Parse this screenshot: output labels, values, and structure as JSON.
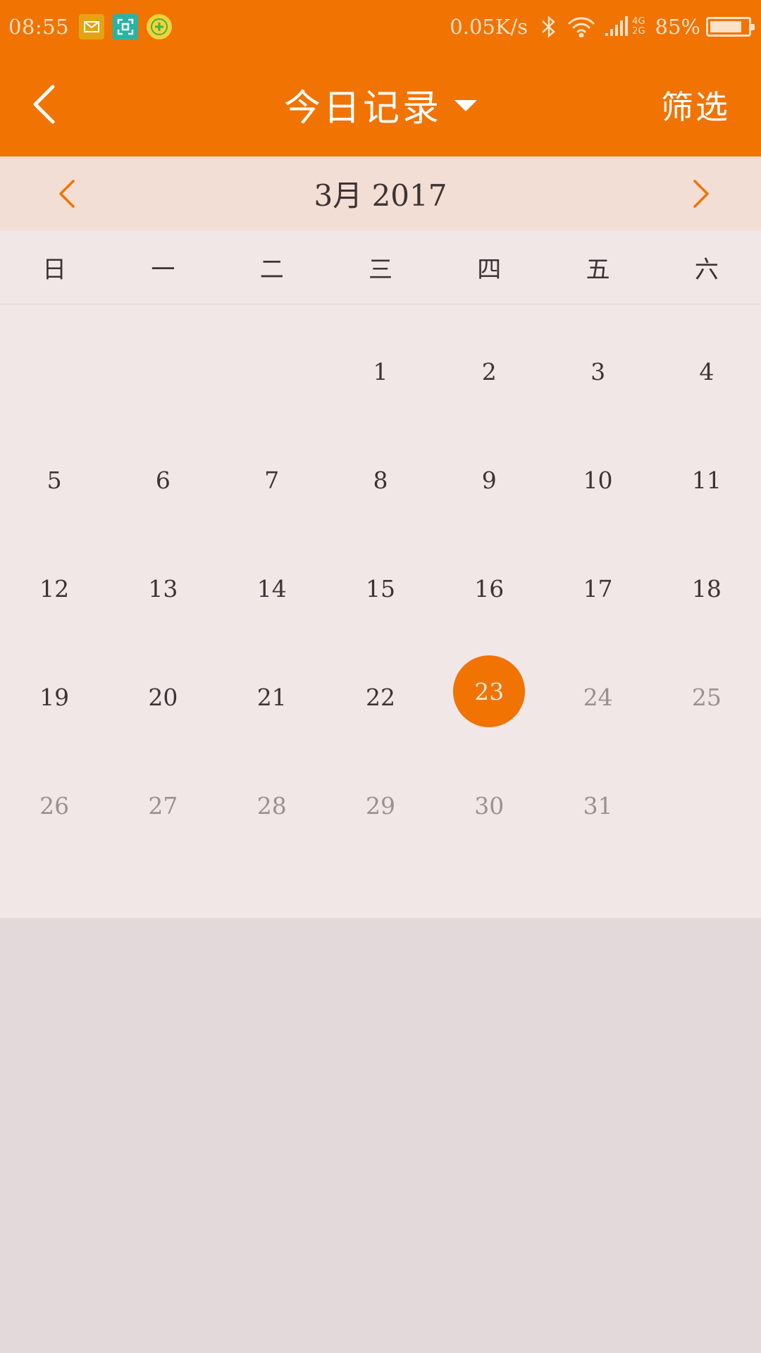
{
  "status_bar": {
    "time": "08:55",
    "net_speed": "0.05K/s",
    "net_type_top": "4G",
    "net_type_bottom": "2G",
    "battery_pct": "85%",
    "battery_level": 0.85,
    "icons": [
      "mail-notification-icon",
      "scan-notification-icon",
      "add-notification-icon",
      "bluetooth-icon",
      "wifi-icon",
      "signal-icon",
      "battery-icon"
    ]
  },
  "toolbar": {
    "title": "今日记录",
    "filter_label": "筛选",
    "back_icon": "chevron-left-icon",
    "title_dropdown_icon": "caret-down-icon"
  },
  "month_nav": {
    "label": "3月 2017",
    "prev_icon": "chevron-left-icon",
    "next_icon": "chevron-right-icon"
  },
  "calendar": {
    "weekdays": [
      "日",
      "一",
      "二",
      "三",
      "四",
      "五",
      "六"
    ],
    "leading_blanks": 3,
    "days_in_month": 31,
    "selected_day": 23,
    "last_enabled_day": 23
  },
  "colors": {
    "accent": "#f17302",
    "month_bar": "#f2ded4",
    "calendar_bg": "#f1e7e6",
    "page_bg": "#e3d8da",
    "text": "#3c3334",
    "text_disabled": "#9c8f90"
  }
}
